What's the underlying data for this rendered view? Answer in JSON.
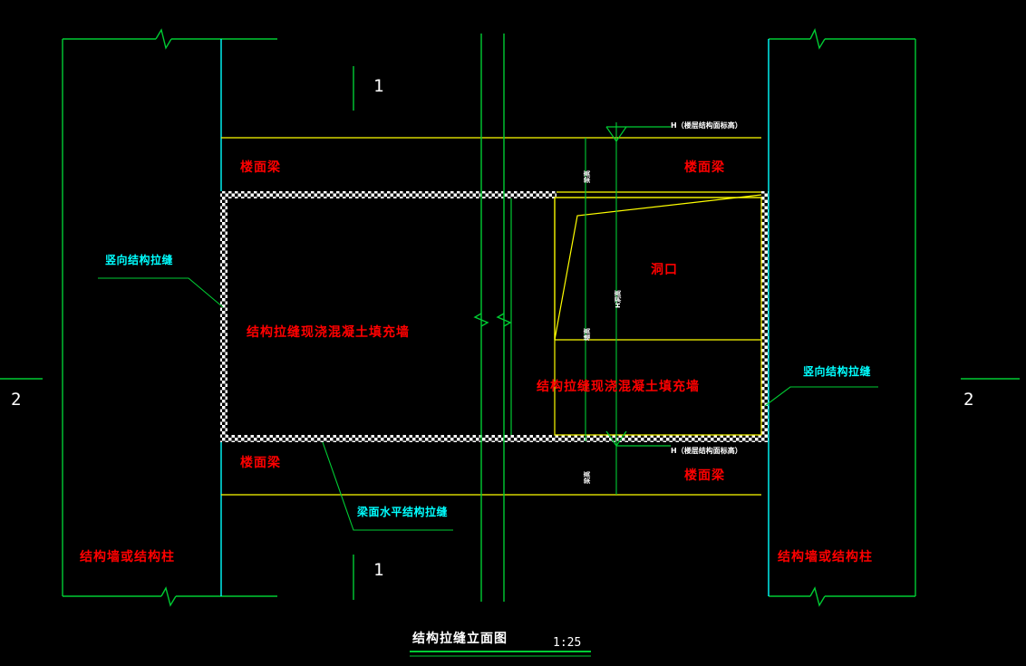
{
  "drawing": {
    "title": "结构拉缝立面图",
    "scale": "1:25",
    "background_color": "#000000",
    "colors": {
      "structure_green": "#00cc33",
      "beam_yellow": "#ffff00",
      "joint_cyan": "#00ffff",
      "annotation_red": "#ff0000",
      "text_white": "#ffffff"
    }
  },
  "section_marks": {
    "top_left": "1",
    "bottom_left": "1",
    "left_side": "2",
    "right_side": "2"
  },
  "labels": {
    "floor_beam": "楼面梁",
    "floor_beam_2": "楼面梁",
    "floor_beam_3": "楼面梁",
    "floor_beam_4": "楼面梁",
    "structural_wall_or_column_left": "结构墙或结构柱",
    "structural_wall_or_column_right": "结构墙或结构柱",
    "vertical_structural_joint_left": "竖向结构拉缝",
    "vertical_structural_joint_right": "竖向结构拉缝",
    "beam_top_horizontal_joint": "梁面水平结构拉缝",
    "cast_in_place_infill_wall_left": "结构拉缝现浇混凝土填充墙",
    "cast_in_place_infill_wall_right": "结构拉缝现浇混凝土填充墙",
    "opening": "洞口",
    "floor_level_top": "H（楼层结构面标高）",
    "floor_level_bottom": "H（楼层结构面标高）",
    "beam_depth_top": "梁高",
    "beam_depth_bottom": "梁高",
    "opening_height": "洞高",
    "wall_height": "墙高",
    "opening_height_dim": "H洞高"
  }
}
